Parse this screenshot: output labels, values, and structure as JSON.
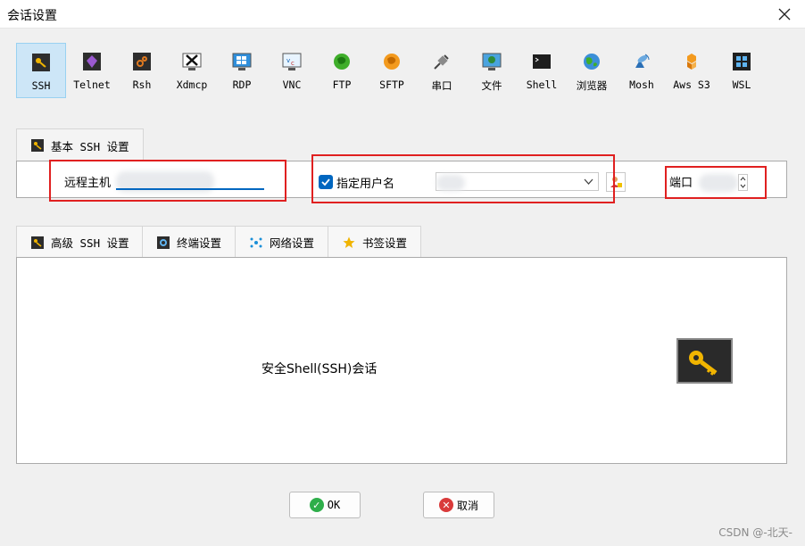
{
  "window": {
    "title": "会话设置"
  },
  "toolbar": {
    "items": [
      {
        "label": "SSH",
        "icon": "ssh-key-icon"
      },
      {
        "label": "Telnet",
        "icon": "telnet-icon"
      },
      {
        "label": "Rsh",
        "icon": "rsh-icon"
      },
      {
        "label": "Xdmcp",
        "icon": "xdmcp-icon"
      },
      {
        "label": "RDP",
        "icon": "rdp-icon"
      },
      {
        "label": "VNC",
        "icon": "vnc-icon"
      },
      {
        "label": "FTP",
        "icon": "ftp-icon"
      },
      {
        "label": "SFTP",
        "icon": "sftp-icon"
      },
      {
        "label": "串口",
        "icon": "serial-icon"
      },
      {
        "label": "文件",
        "icon": "file-icon"
      },
      {
        "label": "Shell",
        "icon": "shell-icon"
      },
      {
        "label": "浏览器",
        "icon": "browser-icon"
      },
      {
        "label": "Mosh",
        "icon": "mosh-icon"
      },
      {
        "label": "Aws S3",
        "icon": "aws-s3-icon"
      },
      {
        "label": "WSL",
        "icon": "wsl-icon"
      }
    ],
    "selected": "SSH"
  },
  "basic": {
    "tab_label": "基本 SSH 设置",
    "remote_host_label": "远程主机",
    "username_label": "指定用户名",
    "username_checked": true,
    "port_label": "端口"
  },
  "advanced_tabs": [
    {
      "label": "高级 SSH 设置"
    },
    {
      "label": "终端设置"
    },
    {
      "label": "网络设置"
    },
    {
      "label": "书签设置"
    }
  ],
  "content": {
    "text": "安全Shell(SSH)会话"
  },
  "buttons": {
    "ok": "OK",
    "cancel": "取消"
  },
  "watermark": "CSDN @-北天-"
}
